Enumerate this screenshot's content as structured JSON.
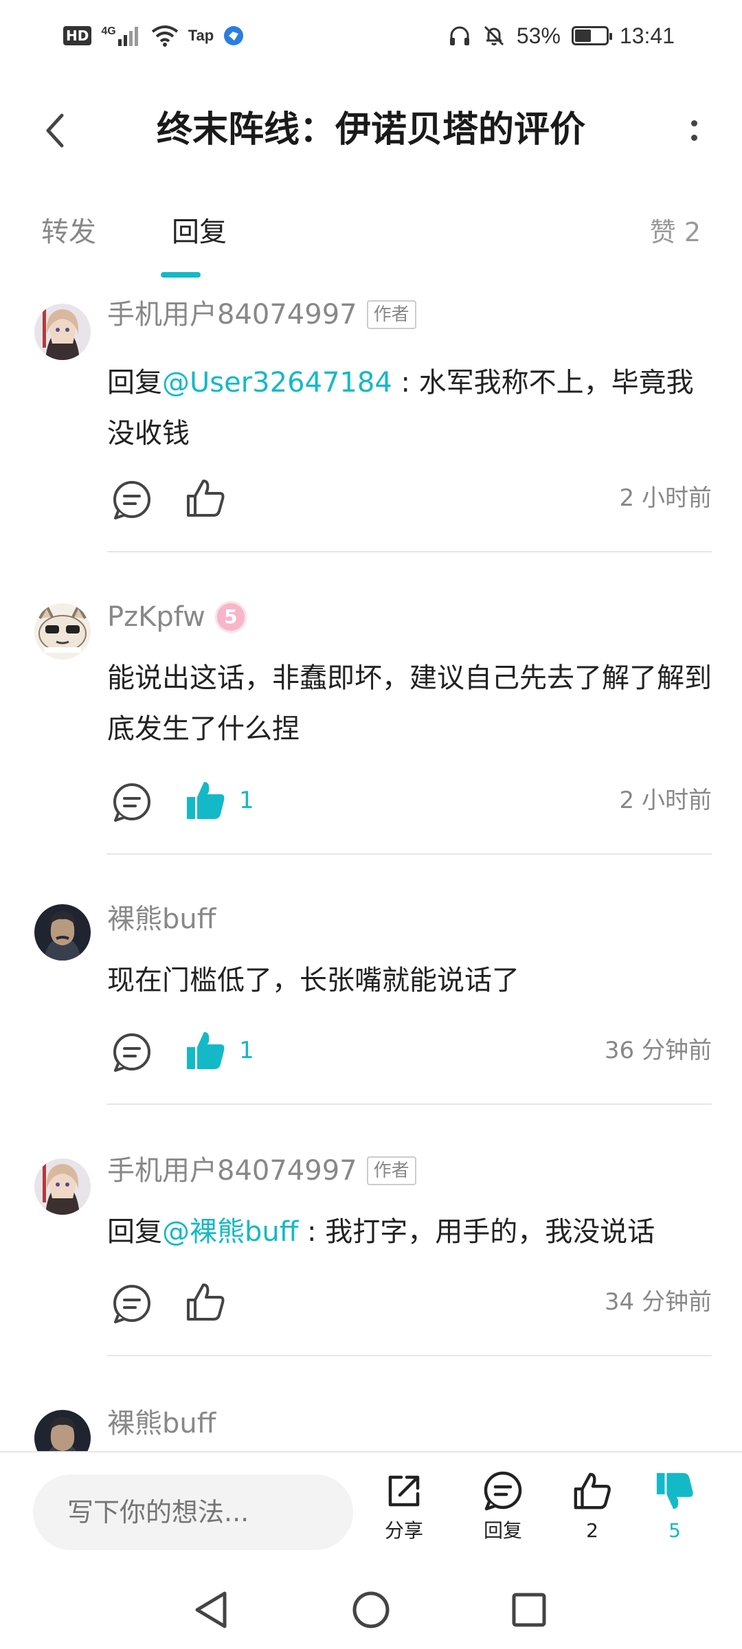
{
  "status_bar": {
    "hd": "HD",
    "network": "4G",
    "app_label": "Tap",
    "battery": "53%",
    "battery_level": 0.53,
    "time": "13:41"
  },
  "header": {
    "title": "终末阵线：伊诺贝塔的评价"
  },
  "tabs": {
    "items": [
      {
        "label": "转发",
        "active": false
      },
      {
        "label": "回复",
        "active": true
      }
    ],
    "like_label": "赞 2"
  },
  "accent_color": "#14b9c8",
  "comments": [
    {
      "user": "手机用户84074997",
      "tag": "作者",
      "reply_prefix": "回复",
      "mention": "@User32647184",
      "text": " : 水军我称不上，毕竟我没收钱",
      "liked": false,
      "likes": "",
      "time": "2 小时前"
    },
    {
      "user": "PzKpfw",
      "level": "5",
      "text": "能说出这话，非蠢即坏，建议自己先去了解了解到底发生了什么捏",
      "liked": true,
      "likes": "1",
      "time": "2 小时前"
    },
    {
      "user": "裸熊buff",
      "text": "现在门槛低了，长张嘴就能说话了",
      "liked": true,
      "likes": "1",
      "time": "36 分钟前"
    },
    {
      "user": "手机用户84074997",
      "tag": "作者",
      "reply_prefix": "回复",
      "mention": "@裸熊buff",
      "text": " : 我打字，用手的，我没说话",
      "liked": false,
      "likes": "",
      "time": "34 分钟前"
    },
    {
      "user": "裸熊buff"
    }
  ],
  "bottom_bar": {
    "input_placeholder": "写下你的想法...",
    "share_label": "分享",
    "reply_label": "回复",
    "like_count": "2",
    "dislike_count": "5"
  }
}
